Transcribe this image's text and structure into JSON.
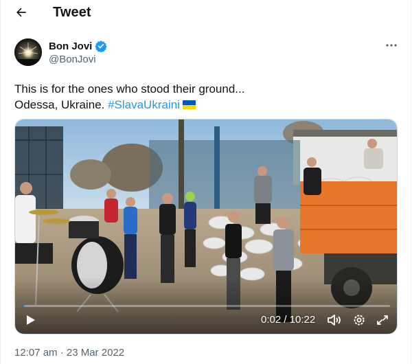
{
  "header": {
    "title": "Tweet",
    "back_icon": "arrow-left-icon"
  },
  "author": {
    "display_name": "Bon Jovi",
    "handle": "@BonJovi",
    "verified": true,
    "verified_color": "#1d9bf0",
    "more_icon": "more-horizontal-icon"
  },
  "tweet": {
    "line1": "This is for the ones who stood their ground...",
    "line2_text": "Odessa, Ukraine.",
    "hashtag": "#SlavaUkraini",
    "flag_emoji": "ukraine-flag",
    "flag_colors": [
      "#0057b7",
      "#ffd700"
    ],
    "hashtag_color": "#1d9bf0"
  },
  "media": {
    "type": "video",
    "time_display": "0:02 / 10:22",
    "progress_fraction": 0.0032,
    "controls": [
      "play-icon",
      "volume-icon",
      "settings-icon",
      "fullscreen-icon"
    ]
  },
  "meta": {
    "timestamp": "12:07 am · 23 Mar 2022"
  }
}
